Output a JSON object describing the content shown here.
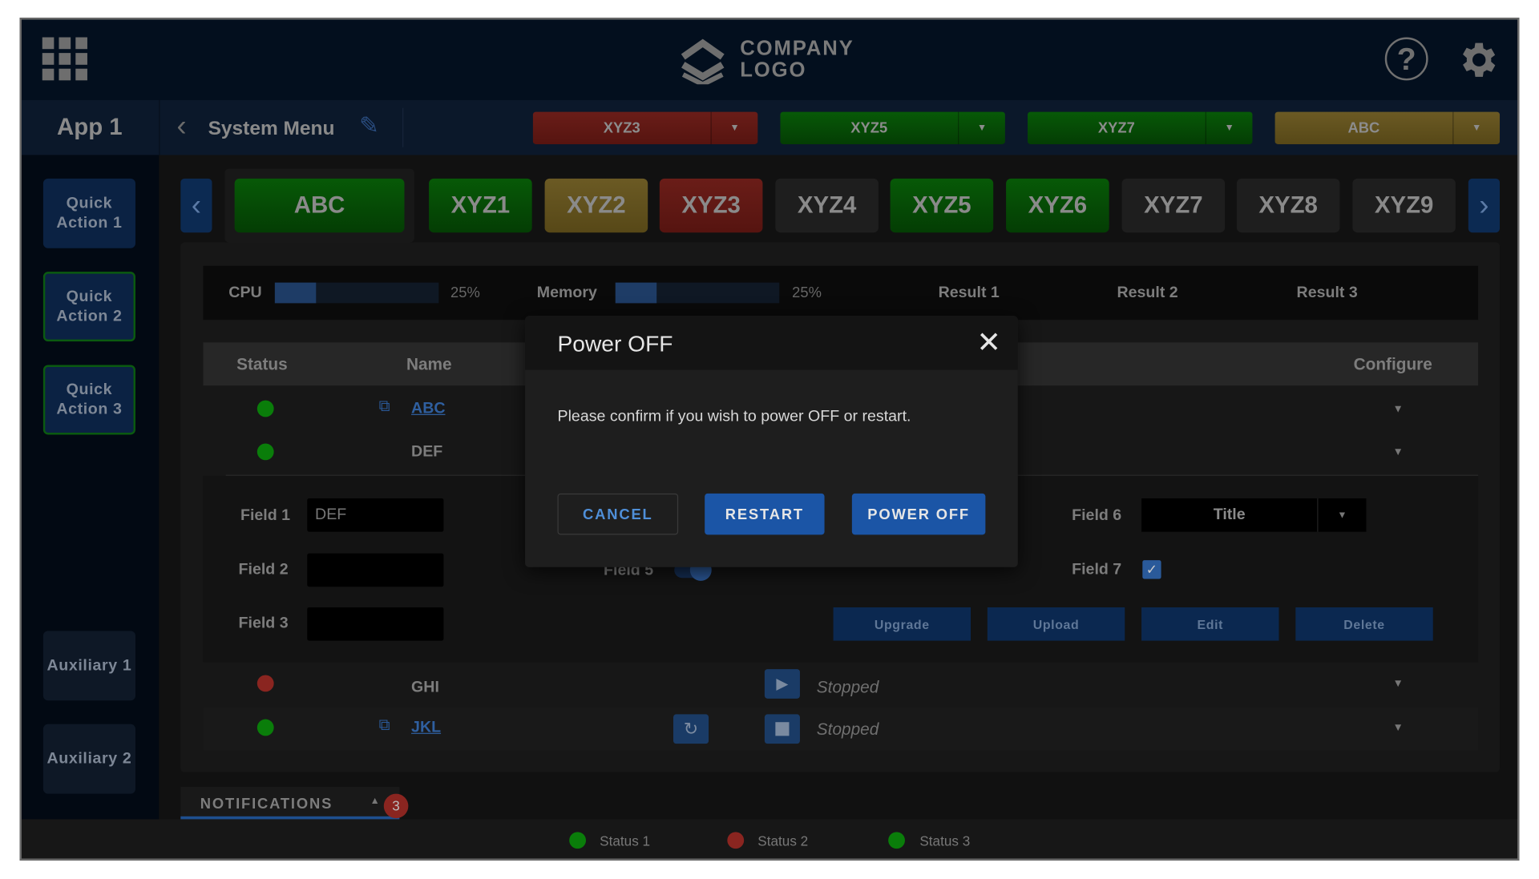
{
  "header": {
    "logo_line1": "COMPANY",
    "logo_line2": "LOGO"
  },
  "toolbar": {
    "app_name": "App 1",
    "menu_title": "System Menu",
    "dropdowns": [
      {
        "label": "XYZ3",
        "color": "#6a1d18"
      },
      {
        "label": "XYZ5",
        "color": "#075907"
      },
      {
        "label": "XYZ7",
        "color": "#075907"
      },
      {
        "label": "ABC",
        "color": "#6b5a24"
      }
    ]
  },
  "sidebar": {
    "items": [
      "Quick Action 1",
      "Quick Action 2",
      "Quick Action 3",
      "Auxiliary 1",
      "Auxiliary 2"
    ]
  },
  "tabs": [
    "ABC",
    "XYZ1",
    "XYZ2",
    "XYZ3",
    "XYZ4",
    "XYZ5",
    "XYZ6",
    "XYZ7",
    "XYZ8",
    "XYZ9"
  ],
  "stats": {
    "cpu_label": "CPU",
    "cpu_value": "25%",
    "cpu_percent": 25,
    "mem_label": "Memory",
    "mem_value": "25%",
    "mem_percent": 25,
    "results": [
      "Result 1",
      "Result 2",
      "Result 3"
    ]
  },
  "table": {
    "headers": {
      "status": "Status",
      "name": "Name",
      "configure": "Configure"
    },
    "rows": [
      {
        "name": "ABC",
        "status": "green",
        "link": true
      },
      {
        "name": "DEF",
        "status": "green",
        "link": false
      },
      {
        "name": "GHI",
        "status": "red",
        "state": "Stopped"
      },
      {
        "name": "JKL",
        "status": "green",
        "link": true,
        "state": "Stopped"
      }
    ]
  },
  "details": {
    "field1_label": "Field 1",
    "field1_value": "DEF",
    "field2_label": "Field 2",
    "field3_label": "Field 3",
    "field5_label": "Field 5",
    "field6_label": "Field 6",
    "field6_value": "Title",
    "field7_label": "Field 7",
    "field7_checked": true,
    "actions": [
      "Upgrade",
      "Upload",
      "Edit",
      "Delete"
    ]
  },
  "notifications": {
    "label": "NOTIFICATIONS",
    "count": "3"
  },
  "footer": {
    "statuses": [
      {
        "label": "Status 1",
        "color": "green"
      },
      {
        "label": "Status 2",
        "color": "red"
      },
      {
        "label": "Status 3",
        "color": "green"
      }
    ]
  },
  "modal": {
    "title": "Power OFF",
    "message": "Please confirm if you wish to power OFF or restart.",
    "cancel": "CANCEL",
    "restart": "RESTART",
    "power_off": "POWER OFF"
  }
}
